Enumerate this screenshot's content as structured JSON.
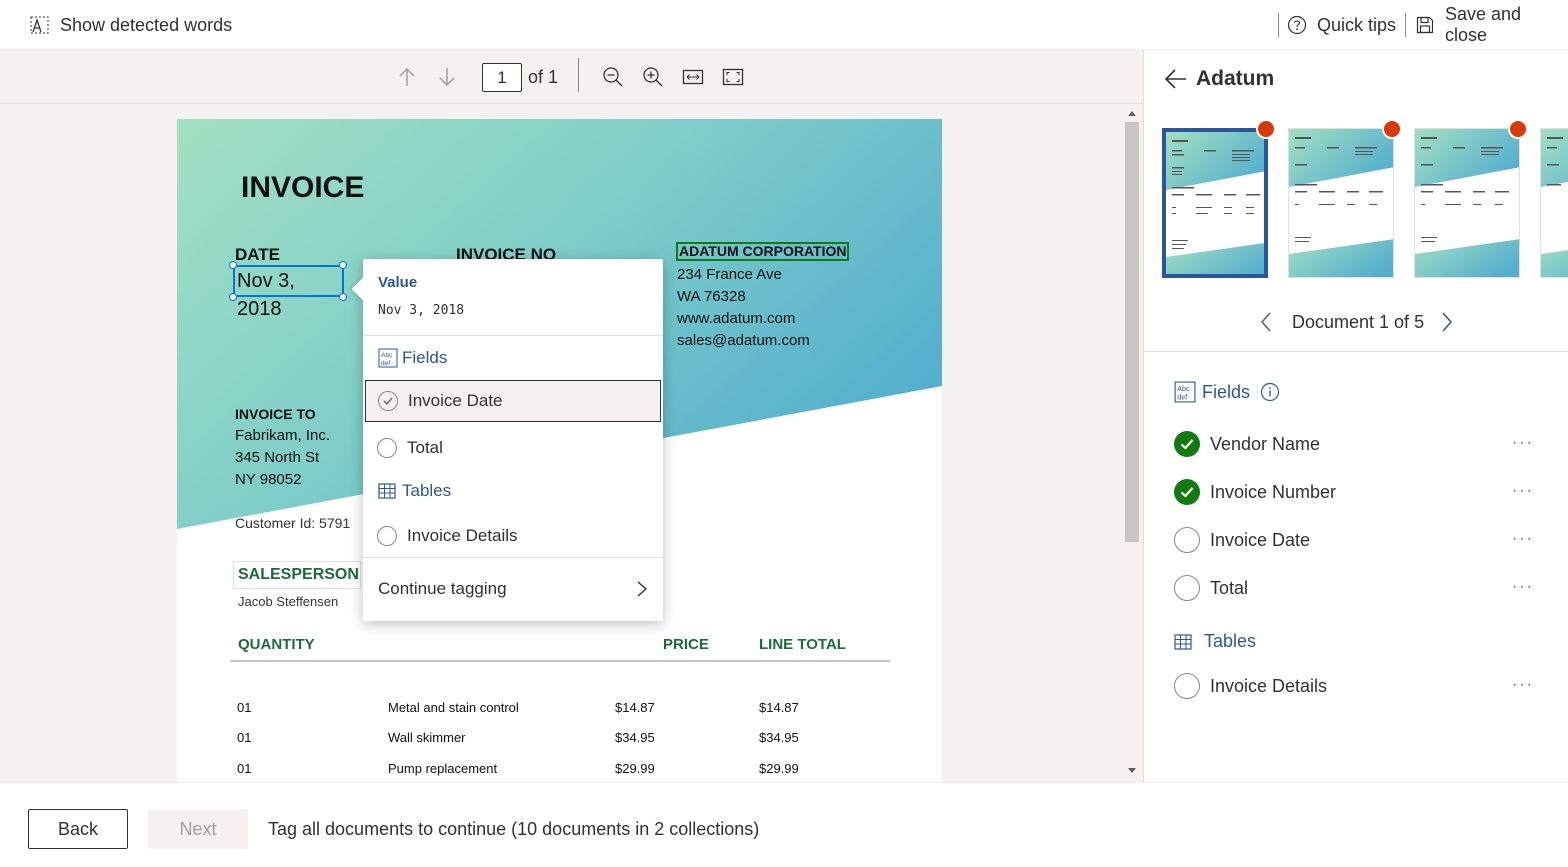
{
  "topbar": {
    "show_words": "Show detected words",
    "quick_tips": "Quick tips",
    "save_close": "Save and close"
  },
  "viewer": {
    "page_current": "1",
    "page_of": "of 1"
  },
  "document": {
    "title": "INVOICE",
    "date_label": "DATE",
    "date_value": "Nov 3, 2018",
    "invoice_no_label": "INVOICE NO",
    "vendor": "ADATUM CORPORATION",
    "vendor_address": [
      "234 France Ave",
      "WA 76328",
      "www.adatum.com",
      "sales@adatum.com"
    ],
    "invoice_to_label": "INVOICE TO",
    "invoice_to": [
      "Fabrikam, Inc.",
      "345 North St",
      "NY 98052"
    ],
    "customer_id": "Customer Id: 5791",
    "salesperson_label": "SALESPERSON",
    "salesperson": "Jacob Steffensen",
    "col_quantity": "QUANTITY",
    "col_price": "PRICE",
    "col_line_total": "LINE TOTAL",
    "rows": [
      {
        "qty": "01",
        "desc": "Metal and stain control",
        "price": "$14.87",
        "total": "$14.87"
      },
      {
        "qty": "01",
        "desc": "Wall skimmer",
        "price": "$34.95",
        "total": "$34.95"
      },
      {
        "qty": "01",
        "desc": "Pump replacement",
        "price": "$29.99",
        "total": "$29.99"
      }
    ]
  },
  "popup": {
    "value_label": "Value",
    "value": "Nov 3, 2018",
    "fields_label": "Fields",
    "option_invoice_date": "Invoice Date",
    "option_total": "Total",
    "tables_label": "Tables",
    "option_invoice_details": "Invoice Details",
    "continue": "Continue tagging"
  },
  "rpanel": {
    "title": "Adatum",
    "doc_nav": "Document 1 of 5",
    "fields_label": "Fields",
    "fields": [
      {
        "label": "Vendor Name",
        "done": true
      },
      {
        "label": "Invoice Number",
        "done": true
      },
      {
        "label": "Invoice Date",
        "done": false
      },
      {
        "label": "Total",
        "done": false
      }
    ],
    "tables_label": "Tables",
    "tables": [
      {
        "label": "Invoice Details",
        "done": false
      }
    ],
    "more": "···"
  },
  "footer": {
    "back": "Back",
    "next": "Next",
    "message": "Tag all documents to continue (10 documents in 2 collections)"
  },
  "colors": {
    "accent": "#2b579a",
    "success": "#107c10",
    "alert": "#d83b01",
    "doc_green": "#1d6b3c"
  }
}
